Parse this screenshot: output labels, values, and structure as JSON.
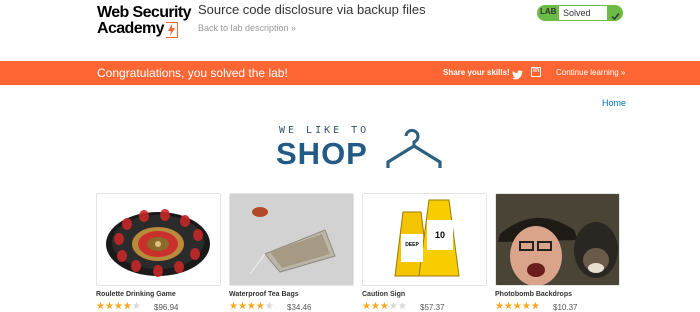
{
  "header": {
    "logo_line1": "Web Security",
    "logo_line2": "Academy",
    "lab_title": "Source code disclosure via backup files",
    "back_link": "Back to lab description »",
    "status_tag": "LAB",
    "status_value": "Solved"
  },
  "banner": {
    "message": "Congratulations, you solved the lab!",
    "share": "Share your skills!",
    "continue": "Continue learning »"
  },
  "nav": {
    "home": "Home"
  },
  "hero": {
    "line1": "WE LIKE TO",
    "line2": "SHOP"
  },
  "products": [
    {
      "name": "Roulette Drinking Game",
      "price": "$96.94",
      "stars": 4
    },
    {
      "name": "Waterproof Tea Bags",
      "price": "$34.46",
      "stars": 4
    },
    {
      "name": "Caution Sign",
      "price": "$57.37",
      "stars": 3
    },
    {
      "name": "Photobomb Backdrops",
      "price": "$10.37",
      "stars": 5
    }
  ],
  "colors": {
    "accent": "#ff6633",
    "solved": "#6cbb46",
    "link": "#0071bc",
    "star": "#f8a81b"
  }
}
